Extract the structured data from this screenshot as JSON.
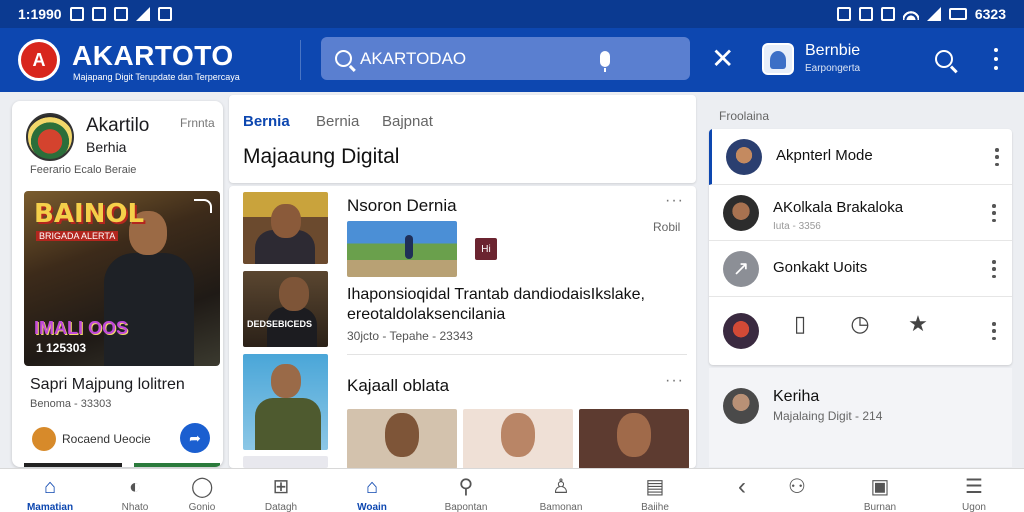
{
  "status_bar": {
    "time": "1:1990",
    "battery": "6323"
  },
  "app": {
    "title": "AKARTOTO",
    "tagline": "Majapang Digit Terupdate dan Terpercaya",
    "logo_text": "A"
  },
  "search": {
    "value": "AKARTODAO"
  },
  "profile": {
    "name": "Bernbie",
    "subtitle": "Earpongerta"
  },
  "left_card": {
    "name": "Akartilo",
    "tag": "Frnnta",
    "subtitle": "Berhia",
    "line": "Feerario Ecalo Beraie",
    "hero_title": "BAINOL",
    "hero_sub": "BRIGADA ALERTA",
    "hero_bottom": "IMALI OOS",
    "hero_number": "1 125303",
    "title": "Sapri Majpung lolitren",
    "meta": "Benoma - 33303",
    "footer_text": "Rocaend Ueocie"
  },
  "middle": {
    "tabs": [
      "Bernia",
      "Bernia",
      "Bajpnat"
    ],
    "title": "Majaaung Digital",
    "item1": {
      "title": "Nsoron Dernia",
      "tag": "Robil",
      "badge": "Hi",
      "body": "Ihaponsioqidal Trantab dandiodaisIkslake, ereotaldolaksencilania",
      "meta": "30jcto - Tepahe - 23343"
    },
    "item2": {
      "title": "Kajaall oblata"
    },
    "thumb_text": "DEDSEBICEDS"
  },
  "right": {
    "section_label": "Froolaina",
    "rows": [
      {
        "title": "Akpnterl Mode",
        "sub": ""
      },
      {
        "title": "AKolkala Brakaloka",
        "sub": "Iuta - 3356"
      },
      {
        "title": "Gonkakt Uoits",
        "sub": ""
      }
    ],
    "bottom": {
      "title": "Keriha",
      "sub": "Majalaing Digit - 214"
    }
  },
  "bottom_nav": [
    {
      "label": "Mamatian",
      "icon": "home-icon"
    },
    {
      "label": "Nhato",
      "icon": "explore-icon"
    },
    {
      "label": "Gonio",
      "icon": "circle-icon"
    },
    {
      "label": "Datagh",
      "icon": "grid-icon"
    },
    {
      "label": "Woain",
      "icon": "home-icon"
    },
    {
      "label": "Bapontan",
      "icon": "search-icon"
    },
    {
      "label": "Bamonan",
      "icon": "person-icon"
    },
    {
      "label": "Baiihe",
      "icon": "book-icon"
    },
    {
      "label": "",
      "icon": "back-icon"
    },
    {
      "label": "",
      "icon": "people-icon"
    },
    {
      "label": "Burnan",
      "icon": "bag-icon"
    },
    {
      "label": "Ugon",
      "icon": "list-icon"
    }
  ],
  "colors": {
    "primary": "#0d47b0",
    "status_bar": "#0b3a91",
    "logo": "#d8261c"
  }
}
